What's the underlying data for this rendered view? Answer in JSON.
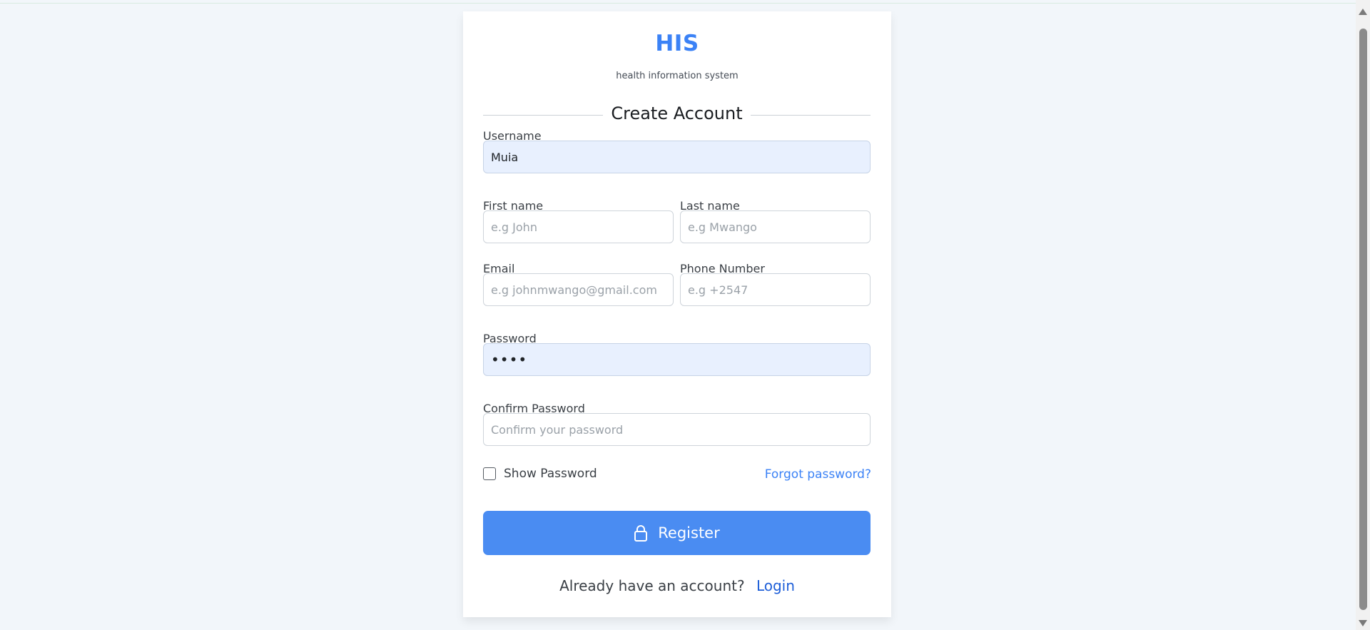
{
  "brand": {
    "title": "HIS",
    "subtitle": "health information system"
  },
  "form": {
    "heading": "Create Account",
    "username": {
      "label": "Username",
      "value": "Muia",
      "placeholder": ""
    },
    "first_name": {
      "label": "First name",
      "value": "",
      "placeholder": "e.g John"
    },
    "last_name": {
      "label": "Last name",
      "value": "",
      "placeholder": "e.g Mwango"
    },
    "email": {
      "label": "Email",
      "value": "",
      "placeholder": "e.g johnmwango@gmail.com"
    },
    "phone": {
      "label": "Phone Number",
      "value": "",
      "placeholder": "e.g +2547"
    },
    "password": {
      "label": "Password",
      "value": "••••",
      "placeholder": ""
    },
    "confirm_password": {
      "label": "Confirm Password",
      "value": "",
      "placeholder": "Confirm your password"
    },
    "show_password": {
      "label": "Show Password",
      "checked": false
    },
    "forgot_password": "Forgot password?",
    "register_button": {
      "label": "Register",
      "icon": "lock-icon"
    },
    "footer": {
      "prompt": "Already have an account?",
      "login_link": "Login"
    }
  },
  "colors": {
    "accent": "#3b82f6",
    "button": "#4a8cf2",
    "background": "#f2f6fa",
    "autofill": "#e8f0fe"
  }
}
